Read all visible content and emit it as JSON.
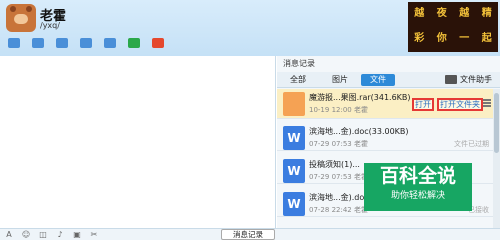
{
  "header": {
    "title": "老霍",
    "subtitle": "/yxq/",
    "toolbar": [
      {
        "icon": "microphone-icon",
        "color": "#4a8fd8"
      },
      {
        "icon": "video-icon",
        "color": "#4a8fd8"
      },
      {
        "icon": "image-icon",
        "color": "#4a8fd8"
      },
      {
        "icon": "folder-icon",
        "color": "#4a8fd8"
      },
      {
        "icon": "screen-share-icon",
        "color": "#4a8fd8"
      },
      {
        "icon": "add-app-icon",
        "color": "#2ba84a"
      },
      {
        "icon": "apps-grid-icon",
        "color": "#e5482d"
      }
    ],
    "banner_chars": [
      "越",
      "夜",
      "越",
      "精",
      "彩",
      "你",
      "一",
      "起",
      "嗨"
    ]
  },
  "input_bar": {
    "icons": [
      "font-icon",
      "emoji-icon",
      "vibrate-icon",
      "microphone-icon",
      "image-icon",
      "scissors-icon"
    ],
    "history_label": "消息记录"
  },
  "panel": {
    "title": "消息记录",
    "tabs": [
      "全部",
      "图片",
      "文件"
    ],
    "active_tab": "文件",
    "folder_helper": "文件助手",
    "items": [
      {
        "name": "魔游报...果图.rar(341.6KB)",
        "meta": "10-19 12:00 老霍",
        "ext": "rar",
        "color": "#f5a254",
        "actions": [
          "打开",
          "打开文件夹"
        ],
        "status": ""
      },
      {
        "name": "滨海地...金).doc(33.00KB)",
        "meta": "07-29 07:53 老霍",
        "ext": "W",
        "color": "#3b7de0",
        "actions": [],
        "status": "文件已过期"
      },
      {
        "name": "投稿须知(1)...",
        "meta": "07-29 07:53 老霍",
        "ext": "W",
        "color": "#3b7de0",
        "actions": [],
        "status": ""
      },
      {
        "name": "滨海地...金).doc(33.00KB)",
        "meta": "07-28 22:42 老霍",
        "ext": "W",
        "color": "#3b7de0",
        "actions": [],
        "status": "已接收"
      }
    ]
  },
  "watermark": {
    "title": "百科全说",
    "subtitle": "助你轻松解决"
  }
}
